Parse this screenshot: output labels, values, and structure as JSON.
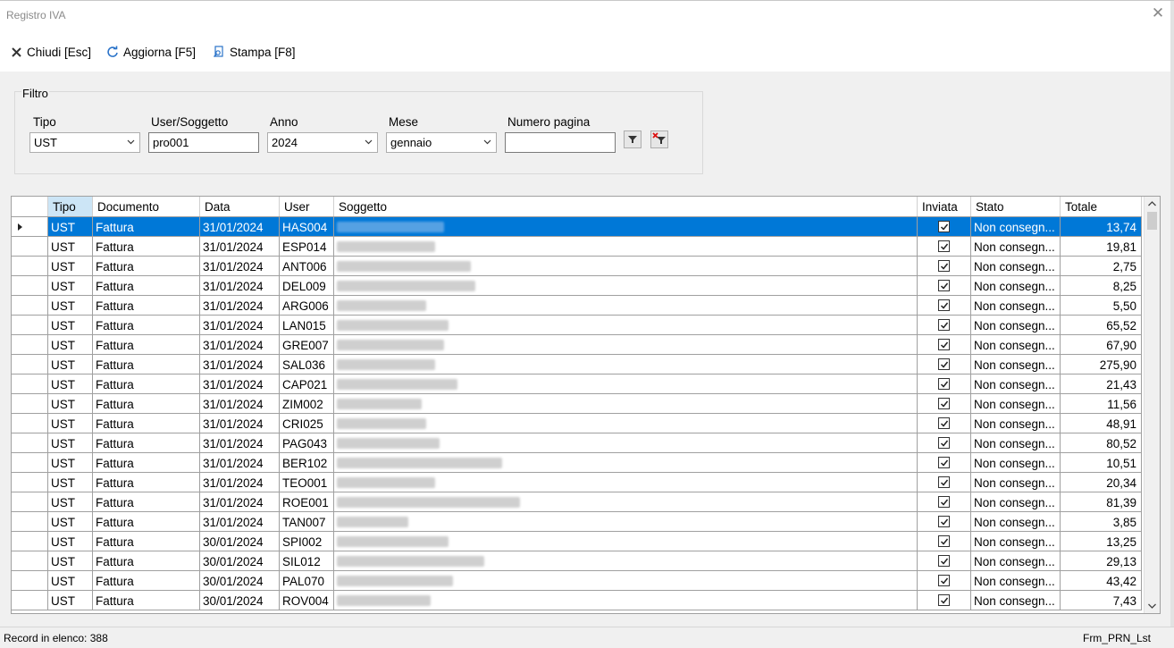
{
  "window": {
    "title": "Registro IVA"
  },
  "toolbar": {
    "close_label": "Chiudi [Esc]",
    "refresh_label": "Aggiorna [F5]",
    "print_label": "Stampa [F8]"
  },
  "filter": {
    "legend": "Filtro",
    "tipo_label": "Tipo",
    "tipo_value": "UST",
    "user_label": "User/Soggetto",
    "user_value": "pro001",
    "anno_label": "Anno",
    "anno_value": "2024",
    "mese_label": "Mese",
    "mese_value": "gennaio",
    "pagina_label": "Numero pagina",
    "pagina_value": ""
  },
  "grid": {
    "columns": [
      "Tipo",
      "Documento",
      "Data",
      "User",
      "Soggetto",
      "Inviata",
      "Stato",
      "Totale"
    ],
    "rows": [
      {
        "tipo": "UST",
        "documento": "Fattura",
        "data": "31/01/2024",
        "user": "HAS004",
        "inviata": true,
        "stato": "Non consegn...",
        "totale": "13,74"
      },
      {
        "tipo": "UST",
        "documento": "Fattura",
        "data": "31/01/2024",
        "user": "ESP014",
        "inviata": true,
        "stato": "Non consegn...",
        "totale": "19,81"
      },
      {
        "tipo": "UST",
        "documento": "Fattura",
        "data": "31/01/2024",
        "user": "ANT006",
        "inviata": true,
        "stato": "Non consegn...",
        "totale": "2,75"
      },
      {
        "tipo": "UST",
        "documento": "Fattura",
        "data": "31/01/2024",
        "user": "DEL009",
        "inviata": true,
        "stato": "Non consegn...",
        "totale": "8,25"
      },
      {
        "tipo": "UST",
        "documento": "Fattura",
        "data": "31/01/2024",
        "user": "ARG006",
        "inviata": true,
        "stato": "Non consegn...",
        "totale": "5,50"
      },
      {
        "tipo": "UST",
        "documento": "Fattura",
        "data": "31/01/2024",
        "user": "LAN015",
        "inviata": true,
        "stato": "Non consegn...",
        "totale": "65,52"
      },
      {
        "tipo": "UST",
        "documento": "Fattura",
        "data": "31/01/2024",
        "user": "GRE007",
        "inviata": true,
        "stato": "Non consegn...",
        "totale": "67,90"
      },
      {
        "tipo": "UST",
        "documento": "Fattura",
        "data": "31/01/2024",
        "user": "SAL036",
        "inviata": true,
        "stato": "Non consegn...",
        "totale": "275,90"
      },
      {
        "tipo": "UST",
        "documento": "Fattura",
        "data": "31/01/2024",
        "user": "CAP021",
        "inviata": true,
        "stato": "Non consegn...",
        "totale": "21,43"
      },
      {
        "tipo": "UST",
        "documento": "Fattura",
        "data": "31/01/2024",
        "user": "ZIM002",
        "inviata": true,
        "stato": "Non consegn...",
        "totale": "11,56"
      },
      {
        "tipo": "UST",
        "documento": "Fattura",
        "data": "31/01/2024",
        "user": "CRI025",
        "inviata": true,
        "stato": "Non consegn...",
        "totale": "48,91"
      },
      {
        "tipo": "UST",
        "documento": "Fattura",
        "data": "31/01/2024",
        "user": "PAG043",
        "inviata": true,
        "stato": "Non consegn...",
        "totale": "80,52"
      },
      {
        "tipo": "UST",
        "documento": "Fattura",
        "data": "31/01/2024",
        "user": "BER102",
        "inviata": true,
        "stato": "Non consegn...",
        "totale": "10,51"
      },
      {
        "tipo": "UST",
        "documento": "Fattura",
        "data": "31/01/2024",
        "user": "TEO001",
        "inviata": true,
        "stato": "Non consegn...",
        "totale": "20,34"
      },
      {
        "tipo": "UST",
        "documento": "Fattura",
        "data": "31/01/2024",
        "user": "ROE001",
        "inviata": true,
        "stato": "Non consegn...",
        "totale": "81,39"
      },
      {
        "tipo": "UST",
        "documento": "Fattura",
        "data": "31/01/2024",
        "user": "TAN007",
        "inviata": true,
        "stato": "Non consegn...",
        "totale": "3,85"
      },
      {
        "tipo": "UST",
        "documento": "Fattura",
        "data": "30/01/2024",
        "user": "SPI002",
        "inviata": true,
        "stato": "Non consegn...",
        "totale": "13,25"
      },
      {
        "tipo": "UST",
        "documento": "Fattura",
        "data": "30/01/2024",
        "user": "SIL012",
        "inviata": true,
        "stato": "Non consegn...",
        "totale": "29,13"
      },
      {
        "tipo": "UST",
        "documento": "Fattura",
        "data": "30/01/2024",
        "user": "PAL070",
        "inviata": true,
        "stato": "Non consegn...",
        "totale": "43,42"
      },
      {
        "tipo": "UST",
        "documento": "Fattura",
        "data": "30/01/2024",
        "user": "ROV004",
        "inviata": true,
        "stato": "Non consegn...",
        "totale": "7,43"
      }
    ]
  },
  "status": {
    "records": "Record in elenco: 388",
    "form_name": "Frm_PRN_Lst"
  },
  "colors": {
    "selection": "#0078d7",
    "header_selected": "#cce5f6"
  }
}
